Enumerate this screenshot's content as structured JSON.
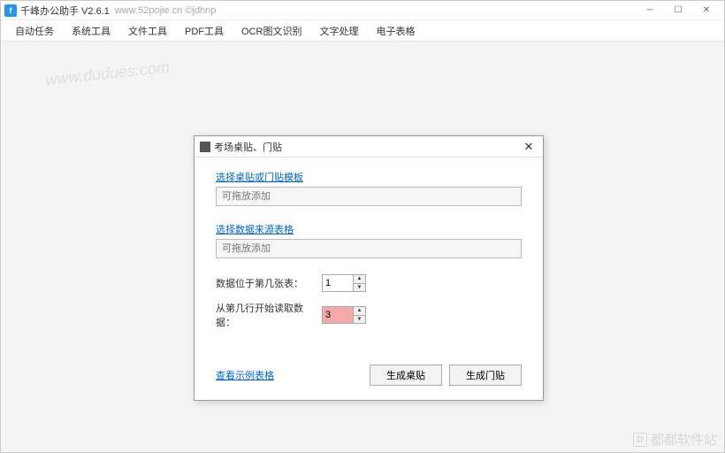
{
  "titlebar": {
    "app_name": "千峰办公助手 V2.6.1",
    "url_text": "www.52pojie.cn ©jdhnp"
  },
  "menu": {
    "items": [
      "自动任务",
      "系统工具",
      "文件工具",
      "PDF工具",
      "OCR图文识别",
      "文字处理",
      "电子表格"
    ]
  },
  "watermark": {
    "main": "www.dudues.com",
    "footer": "都都软件站"
  },
  "dialog": {
    "title": "考场桌贴、门贴",
    "template_link": "选择桌贴或门贴模板",
    "template_placeholder": "可拖放添加",
    "source_link": "选择数据来源表格",
    "source_placeholder": "可拖放添加",
    "sheet_label": "数据位于第几张表：",
    "sheet_value": "1",
    "row_label": "从第几行开始读取数据：",
    "row_value": "3",
    "example_link": "查看示例表格",
    "btn_desk": "生成桌贴",
    "btn_door": "生成门贴"
  }
}
